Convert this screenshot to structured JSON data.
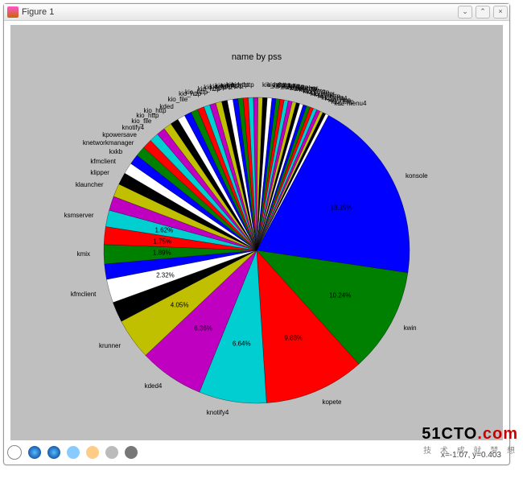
{
  "window": {
    "title": "Figure 1"
  },
  "coord_readout": "x=-1.07, y=0.403",
  "watermark": {
    "main_black": "51CTO",
    "main_red": ".com",
    "sub": "技 术 成 就 梦 想"
  },
  "chart_data": {
    "type": "pie",
    "title": "name by pss",
    "slices": [
      {
        "name": "konsole",
        "value": 18.19,
        "show_pct": true,
        "color": "#0000ff"
      },
      {
        "name": "kwin",
        "value": 10.24,
        "show_pct": true,
        "color": "#008000"
      },
      {
        "name": "kopete",
        "value": 9.88,
        "show_pct": true,
        "color": "#ff0000"
      },
      {
        "name": "knotify4",
        "value": 6.64,
        "show_pct": true,
        "color": "#00ced1"
      },
      {
        "name": "kded4",
        "value": 6.36,
        "show_pct": true,
        "color": "#c000c0"
      },
      {
        "name": "krunner",
        "value": 4.05,
        "show_pct": true,
        "color": "#c0c000"
      },
      {
        "name": "",
        "value": 2.0,
        "show_pct": false,
        "color": "#000000"
      },
      {
        "name": "kfmclient",
        "value": 2.32,
        "show_pct": true,
        "color": "#ffffff"
      },
      {
        "name": "",
        "value": 1.5,
        "show_pct": false,
        "color": "#0000ff"
      },
      {
        "name": "kmix",
        "value": 1.89,
        "show_pct": true,
        "color": "#008000"
      },
      {
        "name": "",
        "value": 1.75,
        "show_pct": true,
        "color": "#ff0000"
      },
      {
        "name": "ksmserver",
        "value": 1.62,
        "show_pct": true,
        "color": "#00ced1"
      },
      {
        "name": "",
        "value": 1.4,
        "show_pct": false,
        "color": "#c000c0"
      },
      {
        "name": "klauncher",
        "value": 1.3,
        "show_pct": false,
        "color": "#c0c000"
      },
      {
        "name": "klipper",
        "value": 1.2,
        "show_pct": false,
        "color": "#000000"
      },
      {
        "name": "kfmclient",
        "value": 1.1,
        "show_pct": false,
        "color": "#ffffff"
      },
      {
        "name": "kxkb",
        "value": 1.0,
        "show_pct": false,
        "color": "#0000ff"
      },
      {
        "name": "knetworkmanager",
        "value": 1.0,
        "show_pct": false,
        "color": "#008000"
      },
      {
        "name": "kpowersave",
        "value": 0.95,
        "show_pct": false,
        "color": "#ff0000"
      },
      {
        "name": "knotify4",
        "value": 0.9,
        "show_pct": false,
        "color": "#00ced1"
      },
      {
        "name": "kio_file",
        "value": 0.85,
        "show_pct": false,
        "color": "#c000c0"
      },
      {
        "name": "kio_http",
        "value": 0.8,
        "show_pct": false,
        "color": "#c0c000"
      },
      {
        "name": "kio_http",
        "value": 0.8,
        "show_pct": false,
        "color": "#000000"
      },
      {
        "name": "kded",
        "value": 0.75,
        "show_pct": false,
        "color": "#ffffff"
      },
      {
        "name": "",
        "value": 0.7,
        "show_pct": false,
        "color": "#0000ff"
      },
      {
        "name": "kio_file",
        "value": 0.7,
        "show_pct": false,
        "color": "#008000"
      },
      {
        "name": "",
        "value": 0.65,
        "show_pct": false,
        "color": "#ff0000"
      },
      {
        "name": "kio_http",
        "value": 0.6,
        "show_pct": false,
        "color": "#00ced1"
      },
      {
        "name": "kio_http",
        "value": 0.6,
        "show_pct": false,
        "color": "#c000c0"
      },
      {
        "name": "",
        "value": 0.6,
        "show_pct": false,
        "color": "#c0c000"
      },
      {
        "name": "kio_http",
        "value": 0.55,
        "show_pct": false,
        "color": "#000000"
      },
      {
        "name": "kio_http",
        "value": 0.55,
        "show_pct": false,
        "color": "#ffffff"
      },
      {
        "name": "kio_http",
        "value": 0.5,
        "show_pct": false,
        "color": "#0000ff"
      },
      {
        "name": "kio_http",
        "value": 0.5,
        "show_pct": false,
        "color": "#008000"
      },
      {
        "name": "kio_http",
        "value": 0.5,
        "show_pct": false,
        "color": "#ff0000"
      },
      {
        "name": "kio_http",
        "value": 0.5,
        "show_pct": false,
        "color": "#00ced1"
      },
      {
        "name": "kio_http",
        "value": 0.45,
        "show_pct": false,
        "color": "#c000c0"
      },
      {
        "name": "kio_http",
        "value": 0.45,
        "show_pct": false,
        "color": "#c0c000"
      },
      {
        "name": "kio_http",
        "value": 0.45,
        "show_pct": false,
        "color": "#000000"
      },
      {
        "name": "kio_http",
        "value": 0.45,
        "show_pct": false,
        "color": "#ffffff"
      },
      {
        "name": "kio_http",
        "value": 0.4,
        "show_pct": false,
        "color": "#0000ff"
      },
      {
        "name": "kio_http",
        "value": 0.4,
        "show_pct": false,
        "color": "#008000"
      },
      {
        "name": "kio_http",
        "value": 0.4,
        "show_pct": false,
        "color": "#ff0000"
      },
      {
        "name": "klauncher",
        "value": 0.4,
        "show_pct": false,
        "color": "#00ced1"
      },
      {
        "name": "kio_http",
        "value": 0.4,
        "show_pct": false,
        "color": "#c000c0"
      },
      {
        "name": "kio_file",
        "value": 0.4,
        "show_pct": false,
        "color": "#c0c000"
      },
      {
        "name": "kio_http",
        "value": 0.35,
        "show_pct": false,
        "color": "#000000"
      },
      {
        "name": "kio_http",
        "value": 0.35,
        "show_pct": false,
        "color": "#ffffff"
      },
      {
        "name": "kio_http",
        "value": 0.35,
        "show_pct": false,
        "color": "#0000ff"
      },
      {
        "name": "kwrited",
        "value": 0.35,
        "show_pct": false,
        "color": "#008000"
      },
      {
        "name": "kio_http",
        "value": 0.35,
        "show_pct": false,
        "color": "#ff0000"
      },
      {
        "name": "kio_http",
        "value": 0.35,
        "show_pct": false,
        "color": "#00ced1"
      },
      {
        "name": "kdeinit4",
        "value": 0.35,
        "show_pct": false,
        "color": "#c000c0"
      },
      {
        "name": "kio_http",
        "value": 0.3,
        "show_pct": false,
        "color": "#c0c000"
      },
      {
        "name": "kio_http",
        "value": 0.3,
        "show_pct": false,
        "color": "#000000"
      },
      {
        "name": "kde-menu4",
        "value": 0.3,
        "show_pct": false,
        "color": "#ffffff"
      }
    ]
  }
}
